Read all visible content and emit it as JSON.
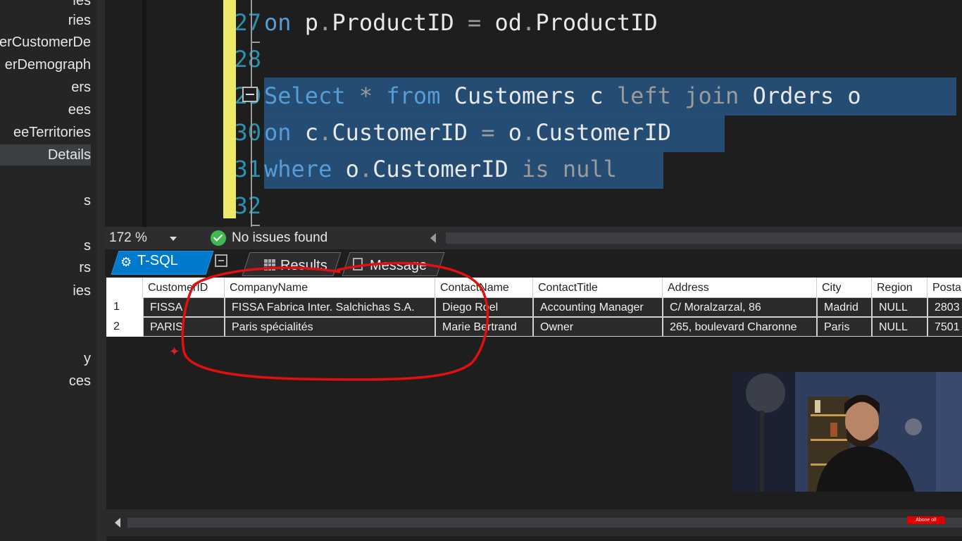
{
  "sidebar": {
    "items": [
      "ries",
      "erCustomerDe",
      "erDemograph",
      "ers",
      "ees",
      "eeTerritories",
      "Details",
      "s",
      "s",
      "rs",
      "ies",
      "y",
      "ces"
    ],
    "top_fragment": "ies",
    "selected_index": 6
  },
  "editor": {
    "line_numbers": [
      "27",
      "28",
      "29",
      "30",
      "31",
      "32"
    ],
    "lines": {
      "l27": {
        "t1": "on",
        "t2": " p",
        "t3": ".",
        "t4": "ProductID ",
        "t5": "=",
        "t6": " od",
        "t7": ".",
        "t8": "ProductID"
      },
      "l29": {
        "t1": "Select",
        "t2": " * ",
        "t3": "from",
        "t4": " Customers c ",
        "t5": "left join",
        "t6": " Orders o"
      },
      "l30": {
        "t1": "on",
        "t2": " c",
        "t3": ".",
        "t4": "CustomerID ",
        "t5": "=",
        "t6": " o",
        "t7": ".",
        "t8": "CustomerID"
      },
      "l31": {
        "t1": "where",
        "t2": " o",
        "t3": ".",
        "t4": "CustomerID ",
        "t5": "is null"
      }
    }
  },
  "status": {
    "zoom": "172 %",
    "issues": "No issues found"
  },
  "tabs": {
    "tsql": "T-SQL",
    "results": "Results",
    "message": "Message"
  },
  "results": {
    "columns": [
      "CustomerID",
      "CompanyName",
      "ContactName",
      "ContactTitle",
      "Address",
      "City",
      "Region",
      "Posta"
    ],
    "rows": [
      {
        "num": "1",
        "cells": [
          "FISSA",
          "FISSA Fabrica Inter. Salchichas S.A.",
          "Diego Roel",
          "Accounting Manager",
          "C/ Moralzarzal, 86",
          "Madrid",
          "NULL",
          "2803"
        ]
      },
      {
        "num": "2",
        "cells": [
          "PARIS",
          "Paris spécialités",
          "Marie Bertrand",
          "Owner",
          "265, boulevard Charonne",
          "Paris",
          "NULL",
          "7501"
        ]
      }
    ]
  },
  "overlay": {
    "subscribe_label": "Abone ol!"
  },
  "colors": {
    "keyword": "#569cd6",
    "selection": "#264f78",
    "line_number": "#2b91af",
    "change_bar": "#efe96a",
    "annotation": "#e01010"
  }
}
